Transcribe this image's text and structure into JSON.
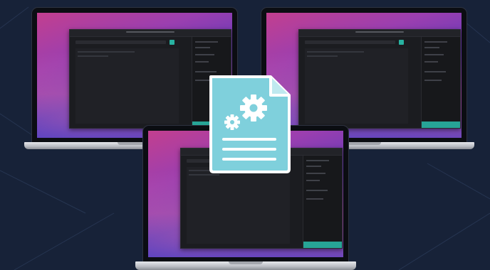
{
  "scene": {
    "description_role": "illustration",
    "laptops": [
      {
        "id": "laptop-left"
      },
      {
        "id": "laptop-right"
      },
      {
        "id": "laptop-center"
      }
    ],
    "center_icon": "document-settings-icon"
  },
  "colors": {
    "background": "#172238",
    "accent_teal": "#28b2a1",
    "icon_fill": "#7fd0dc",
    "icon_stroke": "#ffffff"
  }
}
